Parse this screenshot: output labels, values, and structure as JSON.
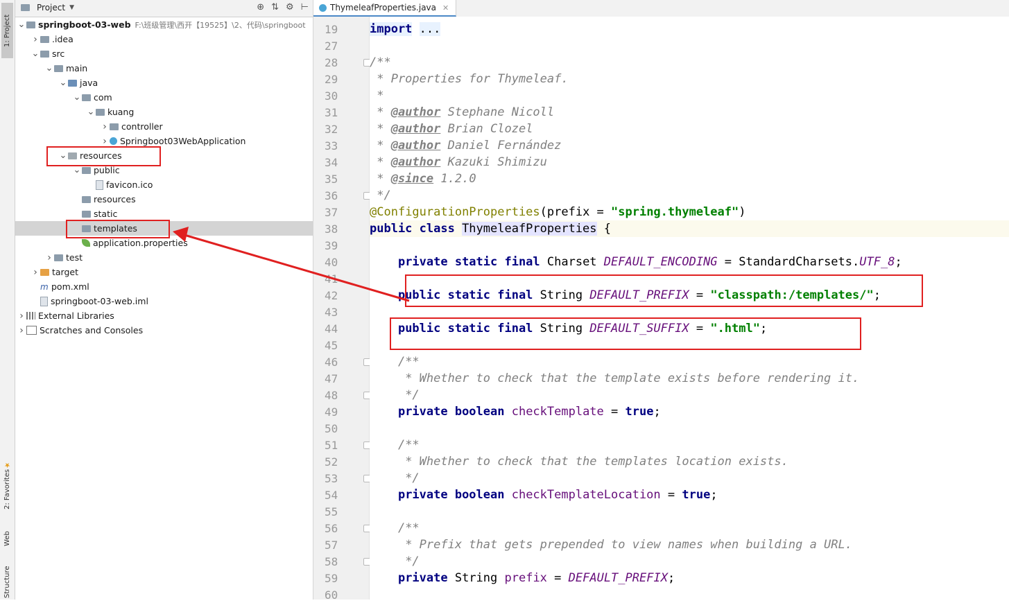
{
  "strip": {
    "project": "1: Project",
    "favorites": "2: Favorites",
    "web": "Web",
    "structure": "Structure"
  },
  "project_panel": {
    "title": "Project",
    "root_path": "F:\\班级管理\\西开【19525】\\2、代码\\springboot",
    "tree": [
      {
        "label": "springboot-03-web",
        "icon": "module-folder-icon",
        "depth": 0,
        "arrow": "down"
      },
      {
        "label": ".idea",
        "icon": "folder-icon",
        "depth": 1,
        "arrow": "right"
      },
      {
        "label": "src",
        "icon": "folder-icon",
        "depth": 1,
        "arrow": "down"
      },
      {
        "label": "main",
        "icon": "folder-icon",
        "depth": 2,
        "arrow": "down"
      },
      {
        "label": "java",
        "icon": "source-folder-icon",
        "depth": 3,
        "arrow": "down"
      },
      {
        "label": "com",
        "icon": "package-icon",
        "depth": 4,
        "arrow": "down"
      },
      {
        "label": "kuang",
        "icon": "package-icon",
        "depth": 5,
        "arrow": "down"
      },
      {
        "label": "controller",
        "icon": "package-icon",
        "depth": 6,
        "arrow": "right"
      },
      {
        "label": "Springboot03WebApplication",
        "icon": "spring-class-icon",
        "depth": 6,
        "arrow": "right"
      },
      {
        "label": "resources",
        "icon": "resources-folder-icon",
        "depth": 3,
        "arrow": "down"
      },
      {
        "label": "public",
        "icon": "folder-icon",
        "depth": 4,
        "arrow": "down"
      },
      {
        "label": "favicon.ico",
        "icon": "file-icon",
        "depth": 5,
        "arrow": ""
      },
      {
        "label": "resources",
        "icon": "folder-icon",
        "depth": 4,
        "arrow": ""
      },
      {
        "label": "static",
        "icon": "folder-icon",
        "depth": 4,
        "arrow": ""
      },
      {
        "label": "templates",
        "icon": "folder-icon",
        "depth": 4,
        "arrow": "",
        "selected": true
      },
      {
        "label": "application.properties",
        "icon": "spring-leaf-icon",
        "depth": 4,
        "arrow": ""
      },
      {
        "label": "test",
        "icon": "folder-icon",
        "depth": 2,
        "arrow": "right"
      },
      {
        "label": "target",
        "icon": "excluded-folder-icon",
        "depth": 1,
        "arrow": "right"
      },
      {
        "label": "pom.xml",
        "icon": "maven-icon",
        "depth": 1,
        "arrow": ""
      },
      {
        "label": "springboot-03-web.iml",
        "icon": "iml-file-icon",
        "depth": 1,
        "arrow": ""
      },
      {
        "label": "External Libraries",
        "icon": "library-icon",
        "depth": 0,
        "arrow": "right"
      },
      {
        "label": "Scratches and Consoles",
        "icon": "scratch-icon",
        "depth": 0,
        "arrow": "right"
      }
    ]
  },
  "editor": {
    "tab_label": "ThymeleafProperties.java",
    "lines": [
      {
        "n": "19",
        "code": ""
      },
      {
        "n": "27",
        "code": ""
      },
      {
        "n": "28",
        "code": ""
      },
      {
        "n": "29",
        "code": ""
      },
      {
        "n": "30",
        "code": ""
      },
      {
        "n": "31",
        "code": ""
      },
      {
        "n": "32",
        "code": ""
      },
      {
        "n": "33",
        "code": ""
      },
      {
        "n": "34",
        "code": ""
      },
      {
        "n": "35",
        "code": ""
      },
      {
        "n": "36",
        "code": ""
      },
      {
        "n": "37",
        "code": ""
      },
      {
        "n": "38",
        "code": ""
      },
      {
        "n": "39",
        "code": ""
      },
      {
        "n": "40",
        "code": ""
      },
      {
        "n": "41",
        "code": ""
      },
      {
        "n": "42",
        "code": ""
      },
      {
        "n": "43",
        "code": ""
      },
      {
        "n": "44",
        "code": ""
      },
      {
        "n": "45",
        "code": ""
      },
      {
        "n": "46",
        "code": ""
      },
      {
        "n": "47",
        "code": ""
      },
      {
        "n": "48",
        "code": ""
      },
      {
        "n": "49",
        "code": ""
      },
      {
        "n": "50",
        "code": ""
      },
      {
        "n": "51",
        "code": ""
      },
      {
        "n": "52",
        "code": ""
      },
      {
        "n": "53",
        "code": ""
      },
      {
        "n": "54",
        "code": ""
      },
      {
        "n": "55",
        "code": ""
      },
      {
        "n": "56",
        "code": ""
      },
      {
        "n": "57",
        "code": ""
      },
      {
        "n": "58",
        "code": ""
      },
      {
        "n": "59",
        "code": ""
      },
      {
        "n": "60",
        "code": ""
      }
    ],
    "text": {
      "import_kw": "import",
      "import_dots": "...",
      "doc_open": "/**",
      "doc_props": " * Properties for Thymeleaf.",
      "doc_star": " *",
      "author_tag": "@author",
      "author1": " Stephane Nicoll",
      "author2": " Brian Clozel",
      "author3": " Daniel Fernández",
      "author4": " Kazuki Shimizu",
      "since_tag": "@since",
      "since_val": " 1.2.0",
      "doc_close": " */",
      "annotation_at": "@",
      "annotation": "ConfigurationProperties",
      "annotation_open": "(prefix = ",
      "prefix_value": "\"spring.thymeleaf\"",
      "annotation_close": ")",
      "class_kw": "public class ",
      "class_name": "ThymeleafProperties",
      "class_brace": " {",
      "psf": "private static final ",
      "charset_type": "Charset ",
      "enc_name": "DEFAULT_ENCODING",
      "enc_eq": " = StandardCharsets.",
      "utf8": "UTF_8",
      "semi": ";",
      "pubsf": "public static final ",
      "string_type": "String ",
      "prefix_name": "DEFAULT_PREFIX",
      "eq": " = ",
      "prefix_str": "\"classpath:/templates/\"",
      "suffix_name": "DEFAULT_SUFFIX",
      "suffix_str": "\".html\"",
      "c_open": "/**",
      "c_check_template": " * Whether to check that the template exists before rendering it.",
      "c_close": " */",
      "private_boolean": "private boolean ",
      "check_template": "checkTemplate",
      "true_kw": "true",
      "c_check_location": " * Whether to check that the templates location exists.",
      "check_location": "checkTemplateLocation",
      "c_prefix": " * Prefix that gets prepended to view names when building a URL.",
      "private_kw": "private ",
      "prefix_field": "prefix",
      "default_prefix_ref": "DEFAULT_PREFIX"
    }
  },
  "annotations": {
    "box_color": "#e02020",
    "arrow_color": "#e02020"
  }
}
